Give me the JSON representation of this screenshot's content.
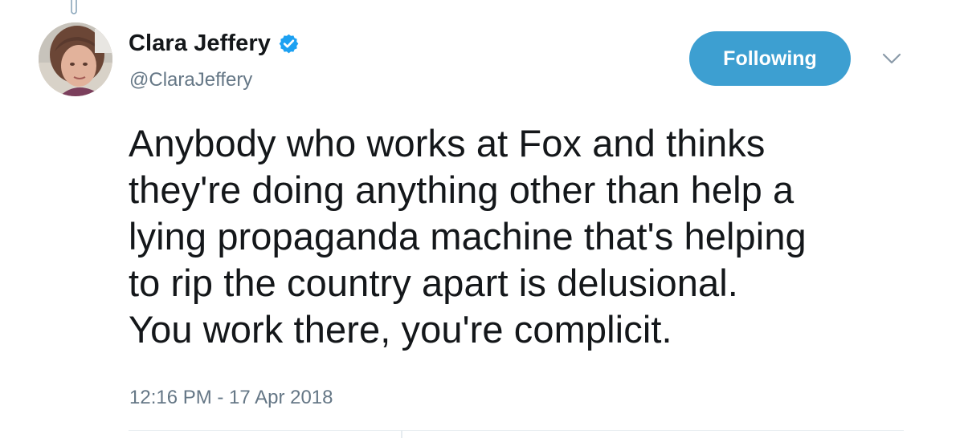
{
  "author": {
    "display_name": "Clara Jeffery",
    "handle": "@ClaraJeffery",
    "verified_icon": "verified-badge-icon",
    "avatar_icon": "profile-photo"
  },
  "actions": {
    "follow_label": "Following",
    "menu_icon": "chevron-down-icon"
  },
  "tweet": {
    "text": "Anybody who works at Fox and thinks\nthey're doing anything other than help a\nlying propaganda machine that's helping\nto rip the country apart is delusional.\nYou work there, you're complicit.",
    "timestamp": "12:16 PM - 17 Apr 2018"
  },
  "colors": {
    "accent": "#3d9fd1",
    "verified": "#1da1f2",
    "secondary_text": "#657786",
    "primary_text": "#14171a"
  }
}
